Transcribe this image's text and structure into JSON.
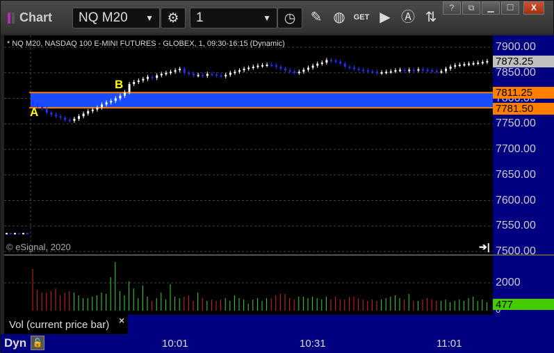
{
  "window": {
    "title": "Chart",
    "symbol": "NQ M20",
    "interval": "1",
    "buttons": [
      "?",
      "restore",
      "minimize",
      "maximize",
      "X"
    ]
  },
  "chart": {
    "header": "* NQ M20, NASDAQ 100 E-MINI FUTURES - GLOBEX, 1, 09:30-16:15 (Dynamic)",
    "copyright": "© eSignal, 2020",
    "price_labels": [
      "7900.00",
      "7850.00",
      "7800.00",
      "7750.00",
      "7700.00",
      "7650.00",
      "7600.00",
      "7550.00",
      "7500.00"
    ],
    "current_price": "7873.25",
    "level_high": "7811.25",
    "level_low": "7781.50",
    "label_a": "A",
    "label_b": "B",
    "colors": {
      "up": "#ffffff",
      "down": "#2030ff",
      "level": "#ff8000",
      "zone": "#1a4cff",
      "vol_up": "#33dd33",
      "vol_down": "#dd2222"
    }
  },
  "volume": {
    "legend": "Vol (current price bar)",
    "close": "×",
    "axis_2000": "2000",
    "axis_0": "0",
    "current": "477"
  },
  "time_axis": {
    "mode": "Dyn",
    "labels": [
      "10:01",
      "10:31",
      "11:01"
    ]
  },
  "chart_data": {
    "type": "candlestick",
    "yrange": [
      7500,
      7920
    ],
    "levels": [
      7811.25,
      7781.5
    ],
    "prior_session_close": 7535,
    "closes": [
      7790,
      7785,
      7780,
      7772,
      7768,
      7765,
      7762,
      7758,
      7756,
      7760,
      7765,
      7770,
      7775,
      7778,
      7782,
      7788,
      7792,
      7795,
      7800,
      7805,
      7812,
      7828,
      7832,
      7835,
      7838,
      7842,
      7840,
      7845,
      7848,
      7850,
      7852,
      7855,
      7858,
      7850,
      7848,
      7845,
      7846,
      7844,
      7848,
      7847,
      7845,
      7843,
      7846,
      7850,
      7852,
      7855,
      7858,
      7860,
      7862,
      7864,
      7865,
      7866,
      7865,
      7862,
      7858,
      7855,
      7853,
      7850,
      7852,
      7856,
      7860,
      7864,
      7868,
      7870,
      7875,
      7874,
      7872,
      7868,
      7862,
      7860,
      7858,
      7856,
      7855,
      7853,
      7852,
      7850,
      7851,
      7852,
      7853,
      7855,
      7856,
      7854,
      7856,
      7855,
      7857,
      7856,
      7855,
      7854,
      7852,
      7853,
      7858,
      7862,
      7865,
      7866,
      7867,
      7868,
      7869,
      7870,
      7871,
      7873
    ],
    "volumes": [
      3000,
      1500,
      1300,
      1300,
      1400,
      1600,
      1100,
      1300,
      1400,
      1300,
      1100,
      900,
      900,
      1000,
      1100,
      1300,
      1200,
      2400,
      3500,
      1400,
      1100,
      2100,
      1600,
      900,
      1800,
      1000,
      700,
      900,
      1300,
      800,
      1900,
      1000,
      900,
      1000,
      1100,
      700,
      1300,
      900,
      700,
      800,
      700,
      800,
      900,
      700,
      1100,
      900,
      800,
      500,
      800,
      900,
      700,
      900,
      900,
      1100,
      1200,
      1200,
      900,
      800,
      1000,
      1000,
      900,
      1000,
      900,
      800,
      1000,
      800,
      1000,
      800,
      800,
      1000,
      1000,
      900,
      800,
      700,
      800,
      700,
      800,
      900,
      1000,
      1100,
      900,
      800,
      1200,
      700,
      700,
      800,
      900,
      800,
      700,
      700,
      800,
      600,
      700,
      800,
      700,
      900,
      1000,
      700,
      800,
      600
    ]
  }
}
